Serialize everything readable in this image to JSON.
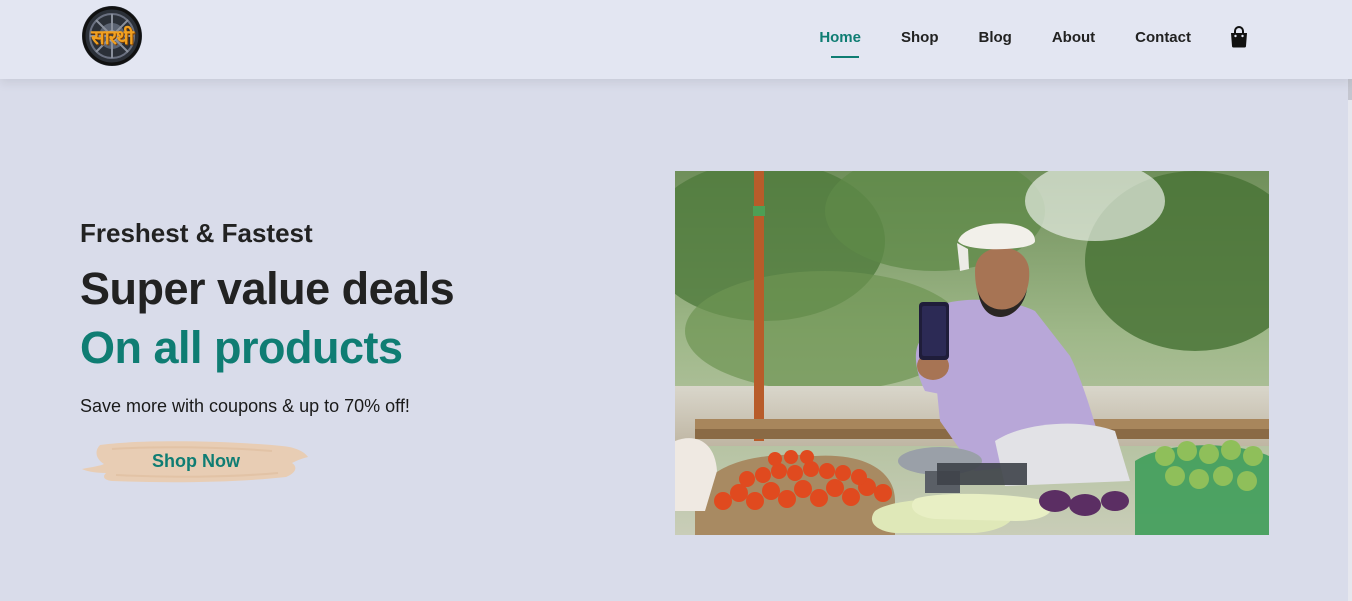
{
  "header": {
    "logo_text": "सारथी",
    "nav": [
      {
        "label": "Home",
        "active": true
      },
      {
        "label": "Shop",
        "active": false
      },
      {
        "label": "Blog",
        "active": false
      },
      {
        "label": "About",
        "active": false
      },
      {
        "label": "Contact",
        "active": false
      }
    ],
    "cart_icon": "shopping-bag-icon"
  },
  "hero": {
    "eyebrow": "Freshest & Fastest",
    "headline": "Super value deals",
    "subheadline": "On all products",
    "tagline": "Save more with coupons & up to 70% off!",
    "cta_label": "Shop Now",
    "image_subject": "vendor-with-phone-at-vegetable-stall"
  },
  "colors": {
    "page_bg": "#d9dcea",
    "header_bg": "#e3e6f2",
    "accent": "#0f7d73",
    "cta_brush": "#e8cdb4",
    "text": "#222222"
  }
}
